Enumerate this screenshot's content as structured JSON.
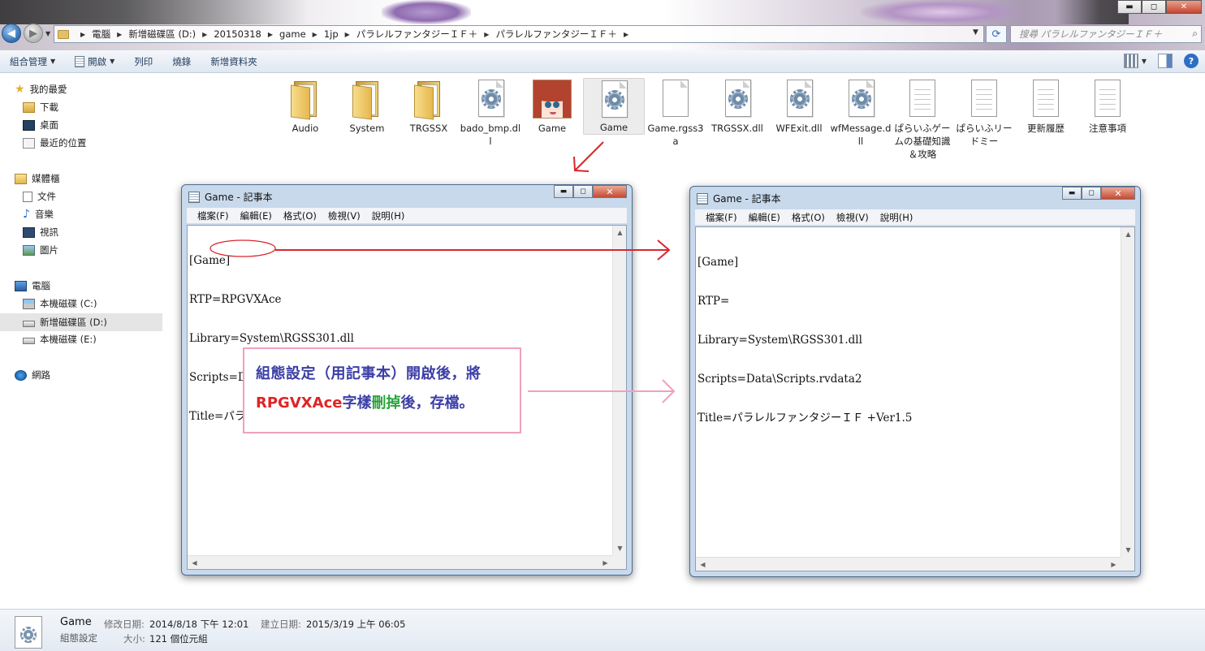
{
  "titlebar": {
    "min": "▬",
    "max": "◻",
    "close": "✕"
  },
  "nav": {
    "back_icon": "back-arrow-icon",
    "breadcrumbs": [
      "電腦",
      "新增磁碟區 (D:)",
      "20150318",
      "game",
      "1jp",
      "パラレルファンタジーＩＦ＋",
      "パラレルファンタジーＩＦ＋"
    ],
    "search_placeholder": "搜尋 パラレルファンタジーＩＦ＋"
  },
  "toolbar": {
    "organize": "組合管理",
    "open": "開啟",
    "print": "列印",
    "burn": "燒錄",
    "new_folder": "新增資料夾"
  },
  "sidebar": {
    "favorites": "我的最愛",
    "downloads": "下載",
    "desktop": "桌面",
    "recent": "最近的位置",
    "libraries": "媒體櫃",
    "documents": "文件",
    "music": "音樂",
    "videos": "視訊",
    "pictures": "圖片",
    "computer": "電腦",
    "drive_c": "本機磁碟 (C:)",
    "drive_d": "新增磁碟區 (D:)",
    "drive_e": "本機磁碟 (E:)",
    "network": "網路"
  },
  "files": [
    {
      "label": "Audio",
      "kind": "folder"
    },
    {
      "label": "System",
      "kind": "folder"
    },
    {
      "label": "TRGSSX",
      "kind": "folder"
    },
    {
      "label": "bado_bmp.dll",
      "kind": "dll"
    },
    {
      "label": "Game",
      "kind": "app-avatar"
    },
    {
      "label": "Game",
      "kind": "config"
    },
    {
      "label": "Game.rgss3a",
      "kind": "blank"
    },
    {
      "label": "TRGSSX.dll",
      "kind": "dll"
    },
    {
      "label": "WFExit.dll",
      "kind": "dll"
    },
    {
      "label": "wfMessage.dll",
      "kind": "dll"
    },
    {
      "label": "ぱらいふゲームの基礎知識＆攻略",
      "kind": "text"
    },
    {
      "label": "ぱらいふリードミー",
      "kind": "text"
    },
    {
      "label": "更新履歴",
      "kind": "text"
    },
    {
      "label": "注意事項",
      "kind": "text"
    }
  ],
  "notepad_left": {
    "title": "Game - 記事本",
    "menu": [
      "檔案(F)",
      "編輯(E)",
      "格式(O)",
      "檢視(V)",
      "說明(H)"
    ],
    "lines": [
      "[Game]",
      "RTP=RPGVXAce",
      "Library=System\\RGSS301.dll",
      "Scripts=Data\\Scripts.rvdata2",
      "Title=パラレルファンタジーＩＦ +Ver1.5"
    ]
  },
  "notepad_right": {
    "title": "Game - 記事本",
    "menu": [
      "檔案(F)",
      "編輯(E)",
      "格式(O)",
      "檢視(V)",
      "說明(H)"
    ],
    "lines": [
      "[Game]",
      "RTP=",
      "Library=System\\RGSS301.dll",
      "Scripts=Data\\Scripts.rvdata2",
      "Title=パラレルファンタジーＩＦ +Ver1.5"
    ]
  },
  "callout": {
    "line1": "組態設定（用記事本）開啟後，將",
    "line2_red": "RPGVXAce",
    "line2_a": "字樣",
    "line2_green": "刪掉",
    "line2_b": "後，存檔。"
  },
  "status": {
    "name": "Game",
    "type": "組態設定",
    "modified_key": "修改日期:",
    "modified_val": "2014/8/18 下午 12:01",
    "created_key": "建立日期:",
    "created_val": "2015/3/19 上午 06:05",
    "size_key": "大小:",
    "size_val": "121 個位元組"
  },
  "colors": {
    "arrow_red": "#d9262b",
    "arrow_pink": "#f0a0c0",
    "accent_blue": "#3b3ea6"
  }
}
